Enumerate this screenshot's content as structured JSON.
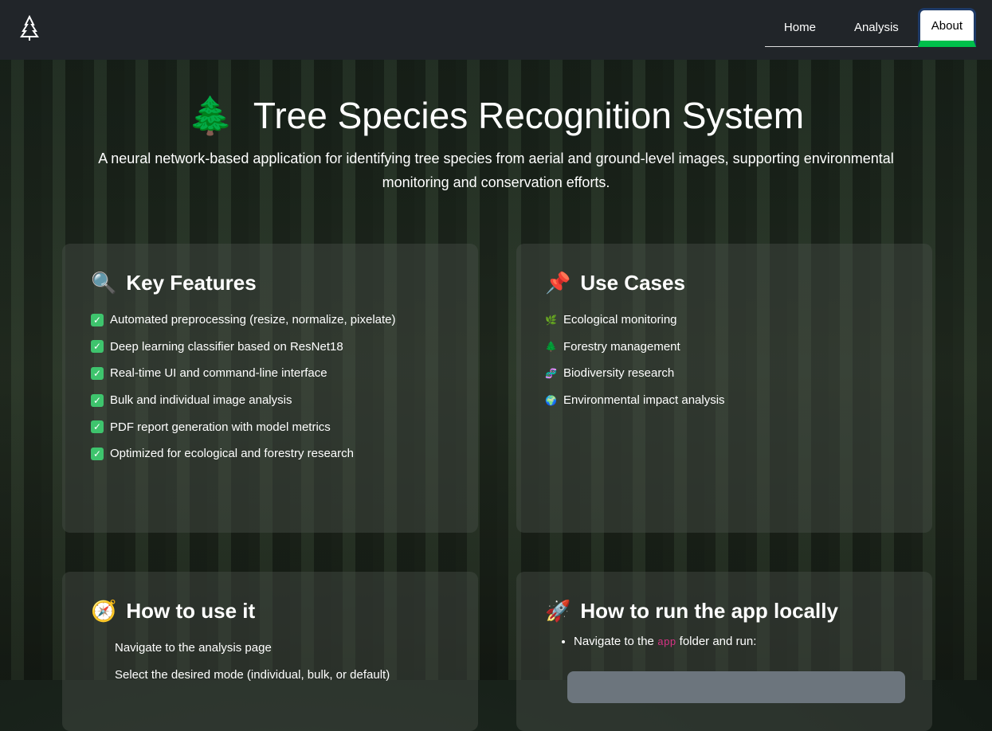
{
  "nav": {
    "items": [
      "Home",
      "Analysis",
      "About"
    ],
    "active": "About"
  },
  "hero": {
    "icon": "🌲",
    "title": "Tree Species Recognition System",
    "subtitle": "A neural network-based application for identifying tree species from aerial and ground-level images, supporting environmental monitoring and conservation efforts."
  },
  "features": {
    "icon": "🔍",
    "title": "Key Features",
    "items": [
      "Automated preprocessing (resize, normalize, pixelate)",
      "Deep learning classifier based on ResNet18",
      "Real-time UI and command-line interface",
      "Bulk and individual image analysis",
      "PDF report generation with model metrics",
      "Optimized for ecological and forestry research"
    ]
  },
  "usecases": {
    "icon": "📌",
    "title": "Use Cases",
    "items": [
      {
        "icon": "🌿",
        "text": "Ecological monitoring"
      },
      {
        "icon": "🌲",
        "text": "Forestry management"
      },
      {
        "icon": "🧬",
        "text": "Biodiversity research"
      },
      {
        "icon": "🌍",
        "text": "Environmental impact analysis"
      }
    ]
  },
  "howto": {
    "icon": "🧭",
    "title": "How to use it",
    "steps": [
      "Navigate to the analysis page",
      "Select the desired mode (individual, bulk, or default)"
    ]
  },
  "run": {
    "icon": "🚀",
    "title": "How to run the app locally",
    "pre": "Navigate to the ",
    "code": "app",
    "post": " folder and run:"
  }
}
